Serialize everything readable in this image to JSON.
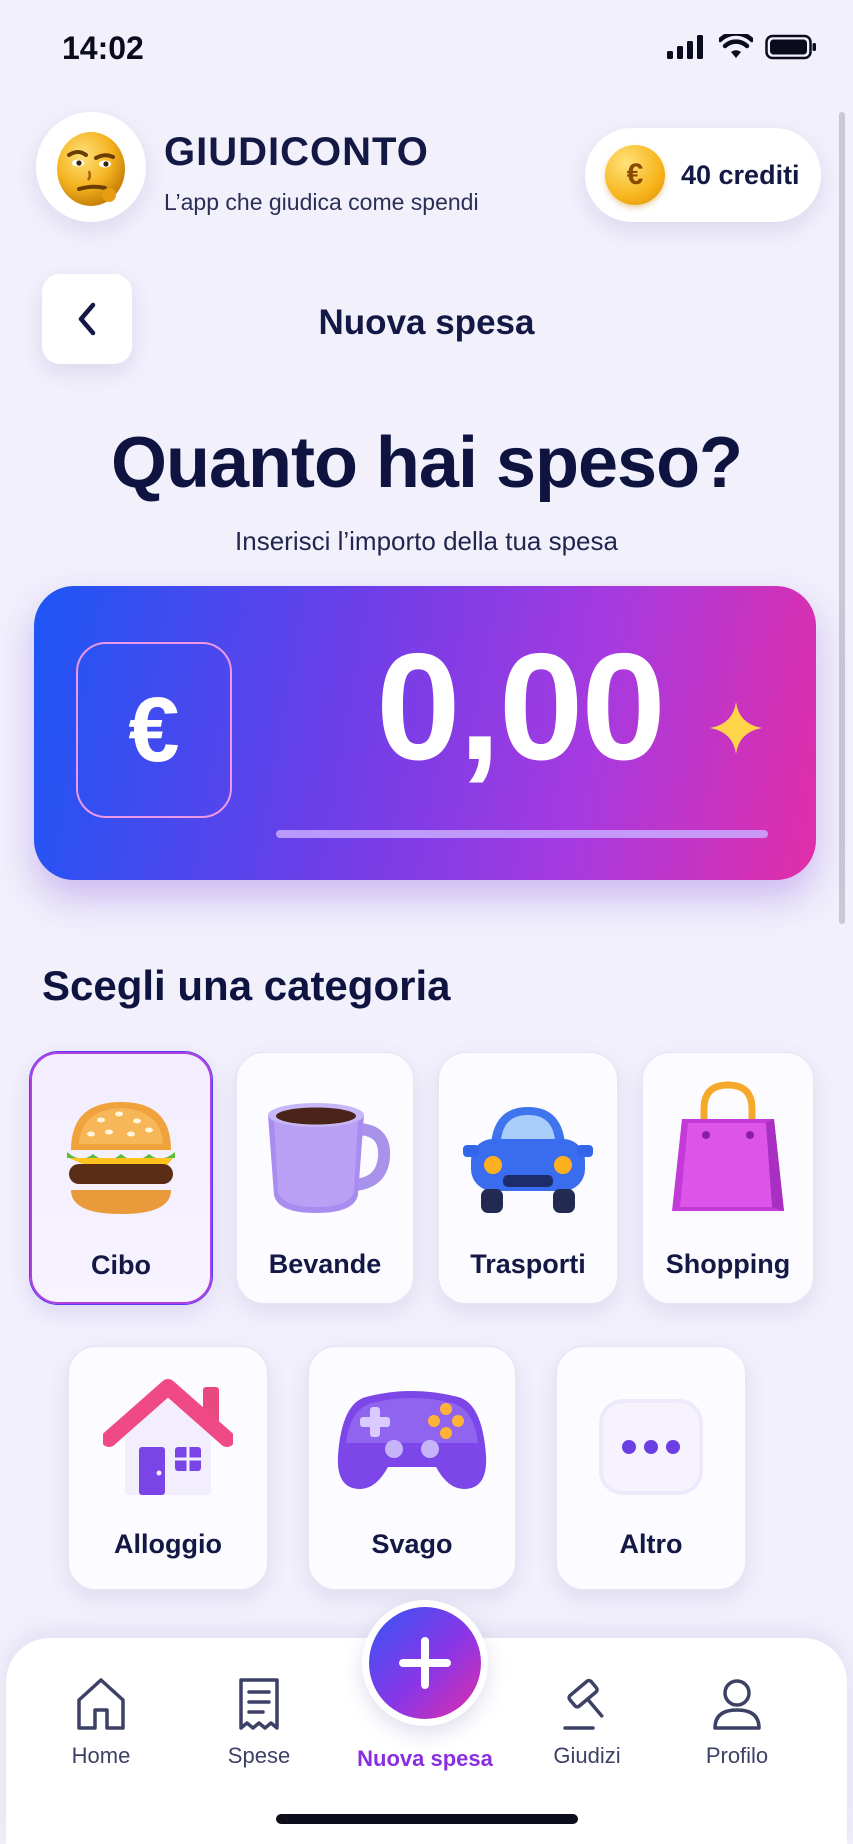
{
  "status_bar": {
    "time": "14:02"
  },
  "header": {
    "app_title": "GIUDICONTO",
    "app_subtitle": "L’app che giudica come spendi",
    "credits_symbol": "€",
    "credits_label": "40 crediti"
  },
  "nav": {
    "page_title": "Nuova spesa"
  },
  "hero": {
    "title": "Quanto hai speso?",
    "subtitle": "Inserisci l’importo della tua spesa"
  },
  "amount": {
    "currency_symbol": "€",
    "value": "0,00"
  },
  "categories": {
    "section_title": "Scegli una categoria",
    "selected": "Cibo",
    "items": [
      {
        "label": "Cibo",
        "icon": "burger-icon"
      },
      {
        "label": "Bevande",
        "icon": "coffee-mug-icon"
      },
      {
        "label": "Trasporti",
        "icon": "car-icon"
      },
      {
        "label": "Shopping",
        "icon": "shopping-bag-icon"
      },
      {
        "label": "Alloggio",
        "icon": "house-icon"
      },
      {
        "label": "Svago",
        "icon": "gamepad-icon"
      },
      {
        "label": "Altro",
        "icon": "more-dots-icon"
      }
    ]
  },
  "bottom_nav": {
    "items": [
      {
        "label": "Home",
        "icon": "home-icon"
      },
      {
        "label": "Spese",
        "icon": "receipt-icon"
      },
      {
        "label": "Nuova spesa",
        "icon": "plus-icon"
      },
      {
        "label": "Giudizi",
        "icon": "gavel-icon"
      },
      {
        "label": "Profilo",
        "icon": "user-icon"
      }
    ],
    "active": "Nuova spesa"
  },
  "colors": {
    "accent_blue": "#1c56f5",
    "accent_purple": "#8a2fe0",
    "accent_pink": "#e22ea8",
    "background": "#f1f0fb",
    "text_dark": "#0f1340"
  }
}
